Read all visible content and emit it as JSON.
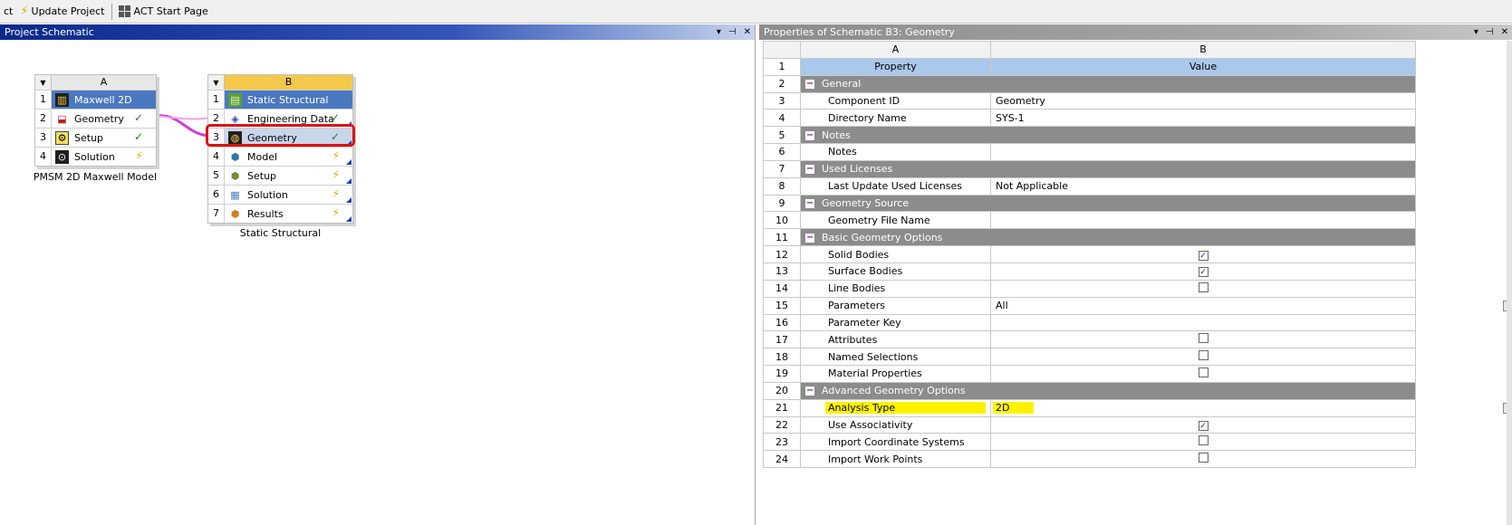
{
  "toolbar": {
    "items": [
      {
        "label": "ct"
      },
      {
        "label": "Update Project",
        "icon": "bolt-icon"
      },
      {
        "label": "ACT Start Page",
        "icon": "grid-icon"
      }
    ]
  },
  "left_pane": {
    "title": "Project Schematic",
    "controls": [
      "▾",
      "⊣",
      "✕"
    ]
  },
  "systems": [
    {
      "column": "A",
      "caption": "PMSM 2D Maxwell Model",
      "cells": [
        {
          "num": "1",
          "label": "Maxwell 2D",
          "state": ""
        },
        {
          "num": "2",
          "label": "Geometry",
          "state": "✓"
        },
        {
          "num": "3",
          "label": "Setup",
          "state": "✓"
        },
        {
          "num": "4",
          "label": "Solution",
          "state": "⚡"
        }
      ]
    },
    {
      "column": "B",
      "caption": "Static Structural",
      "cells": [
        {
          "num": "1",
          "label": "Static Structural",
          "state": ""
        },
        {
          "num": "2",
          "label": "Engineering Data",
          "state": "✓"
        },
        {
          "num": "3",
          "label": "Geometry",
          "state": "✓"
        },
        {
          "num": "4",
          "label": "Model",
          "state": "⚡"
        },
        {
          "num": "5",
          "label": "Setup",
          "state": "⚡"
        },
        {
          "num": "6",
          "label": "Solution",
          "state": "⚡"
        },
        {
          "num": "7",
          "label": "Results",
          "state": "⚡"
        }
      ]
    }
  ],
  "right_pane": {
    "title": "Properties of Schematic B3: Geometry",
    "controls": [
      "▾",
      "⊣",
      "✕"
    ],
    "col_headers": [
      "A",
      "B"
    ],
    "prop_header": {
      "num": "1",
      "property": "Property",
      "value": "Value"
    },
    "rows": [
      {
        "num": "2",
        "type": "cat",
        "label": "General"
      },
      {
        "num": "3",
        "type": "prop",
        "label": "Component ID",
        "value": "Geometry"
      },
      {
        "num": "4",
        "type": "prop",
        "label": "Directory Name",
        "value": "SYS-1"
      },
      {
        "num": "5",
        "type": "cat",
        "label": "Notes"
      },
      {
        "num": "6",
        "type": "prop",
        "label": "Notes",
        "value": ""
      },
      {
        "num": "7",
        "type": "cat",
        "label": "Used Licenses"
      },
      {
        "num": "8",
        "type": "prop",
        "label": "Last Update Used Licenses",
        "value": "Not Applicable"
      },
      {
        "num": "9",
        "type": "cat",
        "label": "Geometry Source"
      },
      {
        "num": "10",
        "type": "prop",
        "label": "Geometry File Name",
        "value": ""
      },
      {
        "num": "11",
        "type": "cat",
        "label": "Basic Geometry Options"
      },
      {
        "num": "12",
        "type": "check",
        "label": "Solid Bodies",
        "checked": true
      },
      {
        "num": "13",
        "type": "check",
        "label": "Surface Bodies",
        "checked": true
      },
      {
        "num": "14",
        "type": "check",
        "label": "Line Bodies",
        "checked": false
      },
      {
        "num": "15",
        "type": "drop",
        "label": "Parameters",
        "value": "All"
      },
      {
        "num": "16",
        "type": "prop",
        "label": "Parameter Key",
        "value": ""
      },
      {
        "num": "17",
        "type": "check",
        "label": "Attributes",
        "checked": false
      },
      {
        "num": "18",
        "type": "check",
        "label": "Named Selections",
        "checked": false
      },
      {
        "num": "19",
        "type": "check",
        "label": "Material Properties",
        "checked": false
      },
      {
        "num": "20",
        "type": "cat",
        "label": "Advanced Geometry Options"
      },
      {
        "num": "21",
        "type": "drop",
        "label": "Analysis Type",
        "value": "2D",
        "highlight": true
      },
      {
        "num": "22",
        "type": "check",
        "label": "Use Associativity",
        "checked": true
      },
      {
        "num": "23",
        "type": "check",
        "label": "Import Coordinate Systems",
        "checked": false
      },
      {
        "num": "24",
        "type": "check",
        "label": "Import Work Points",
        "checked": false
      }
    ]
  },
  "colors": {
    "left_title_bg": "#0a2a8a",
    "highlight_cell": "#4a78c0",
    "category_bg": "#8c8c8c",
    "prop_header_bg": "#aac8ec",
    "selection_outline": "#e01010",
    "link_line": "#d040d0",
    "marker_yellow": "#fff200"
  }
}
